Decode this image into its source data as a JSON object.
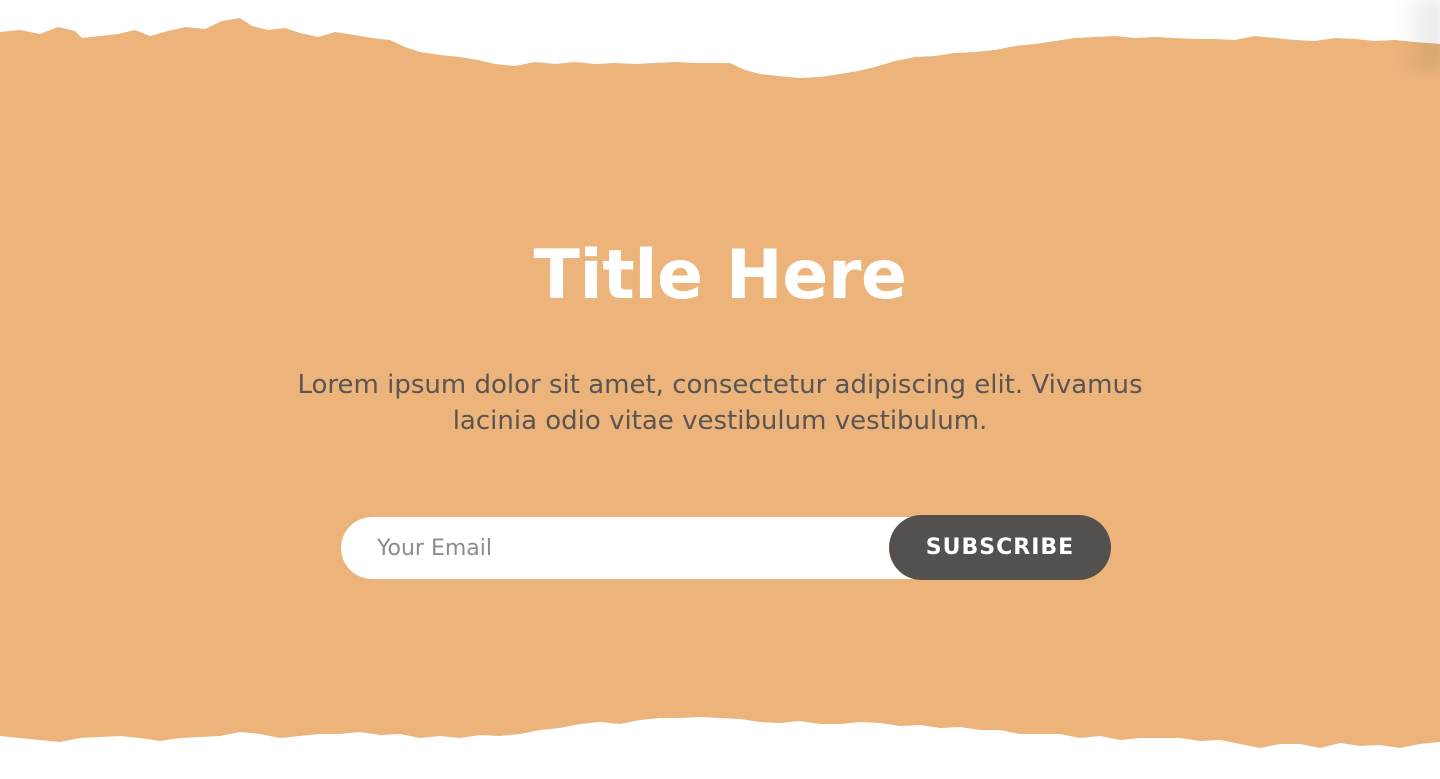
{
  "colors": {
    "background": "#ffffff",
    "banner": "#ecb47b",
    "title": "#ffffff",
    "description": "#5a5552",
    "input_background": "#ffffff",
    "placeholder": "#8c8c8c",
    "button": "#54504d",
    "button_text": "#ffffff"
  },
  "hero": {
    "title": "Title Here",
    "description": "Lorem ipsum dolor sit amet, consectetur adipiscing elit. Vivamus lacinia odio vitae vestibulum vestibulum."
  },
  "subscribe_form": {
    "email_placeholder": "Your Email",
    "email_value": "",
    "button_label": "SUBSCRIBE"
  }
}
